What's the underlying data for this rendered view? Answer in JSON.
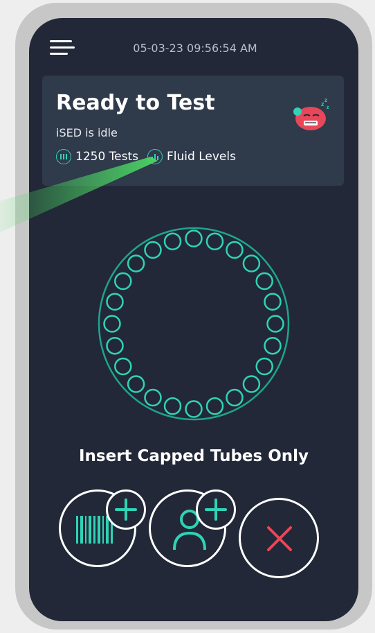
{
  "header": {
    "datetime": "05-03-23 09:56:54 AM",
    "menu_icon": "hamburger-menu-icon"
  },
  "status": {
    "title": "Ready to Test",
    "subtitle": "iSED is idle",
    "tests_label": "1250 Tests",
    "tests_icon": "tube-rack-icon",
    "fluid_label": "Fluid Levels",
    "fluid_icon": "bar-chart-icon",
    "mascot_icon": "sleeping-robot-icon"
  },
  "carousel": {
    "slot_count": 24,
    "occupied_slots": 0
  },
  "instruction": "Insert Capped Tubes Only",
  "actions": {
    "scan_barcode_icon": "barcode-add-icon",
    "add_patient_icon": "add-user-icon",
    "cancel_icon": "close-icon"
  },
  "colors": {
    "background": "#222837",
    "card": "#2f3a4b",
    "accent": "#2fd3b6",
    "carousel_ring": "#1ea58c",
    "cancel": "#e8475a",
    "pointer_beam": "#4cd964"
  }
}
